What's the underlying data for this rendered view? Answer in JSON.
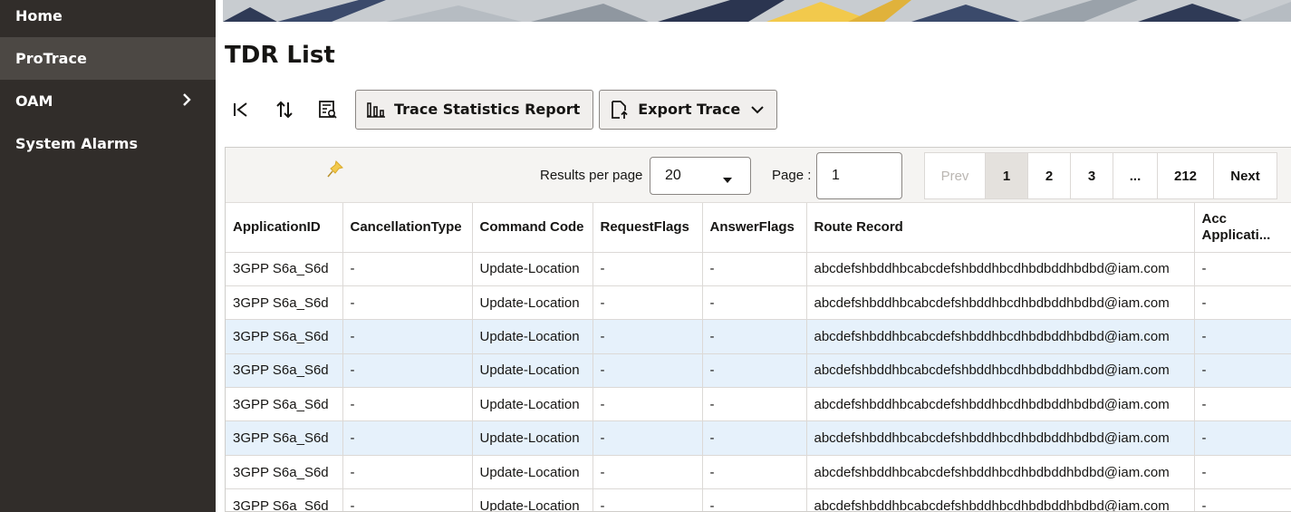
{
  "sidebar": {
    "items": [
      {
        "label": "Home"
      },
      {
        "label": "ProTrace"
      },
      {
        "label": "OAM"
      },
      {
        "label": "System Alarms"
      }
    ]
  },
  "page": {
    "title": "TDR List"
  },
  "toolbar": {
    "first_icon": "first-page-icon",
    "sort_icon": "sort-icon",
    "view_icon": "view-details-icon",
    "trace_stats_label": "Trace Statistics Report",
    "export_label": "Export Trace"
  },
  "pager": {
    "results_label": "Results per page",
    "results_value": "20",
    "page_label": "Page :",
    "page_value": "1",
    "buttons": [
      "Prev",
      "1",
      "2",
      "3",
      "...",
      "212",
      "Next"
    ]
  },
  "table": {
    "headers": [
      "ApplicationID",
      "CancellationType",
      "Command Code",
      "RequestFlags",
      "AnswerFlags",
      "Route Record",
      "Acc Applicati..."
    ],
    "rows": [
      {
        "cells": [
          "3GPP S6a_S6d",
          "-",
          "Update-Location",
          "-",
          "-",
          "abcdefshbddhbcabcdefshbddhbcdhbdbddhbdbd@iam.com",
          "-"
        ],
        "selected": false
      },
      {
        "cells": [
          "3GPP S6a_S6d",
          "-",
          "Update-Location",
          "-",
          "-",
          "abcdefshbddhbcabcdefshbddhbcdhbdbddhbdbd@iam.com",
          "-"
        ],
        "selected": false
      },
      {
        "cells": [
          "3GPP S6a_S6d",
          "-",
          "Update-Location",
          "-",
          "-",
          "abcdefshbddhbcabcdefshbddhbcdhbdbddhbdbd@iam.com",
          "-"
        ],
        "selected": true
      },
      {
        "cells": [
          "3GPP S6a_S6d",
          "-",
          "Update-Location",
          "-",
          "-",
          "abcdefshbddhbcabcdefshbddhbcdhbdbddhbdbd@iam.com",
          "-"
        ],
        "selected": true
      },
      {
        "cells": [
          "3GPP S6a_S6d",
          "-",
          "Update-Location",
          "-",
          "-",
          "abcdefshbddhbcabcdefshbddhbcdhbdbddhbdbd@iam.com",
          "-"
        ],
        "selected": false
      },
      {
        "cells": [
          "3GPP S6a_S6d",
          "-",
          "Update-Location",
          "-",
          "-",
          "abcdefshbddhbcabcdefshbddhbcdhbdbddhbdbd@iam.com",
          "-"
        ],
        "selected": true
      },
      {
        "cells": [
          "3GPP S6a_S6d",
          "-",
          "Update-Location",
          "-",
          "-",
          "abcdefshbddhbcabcdefshbddhbcdhbdbddhbdbd@iam.com",
          "-"
        ],
        "selected": false
      },
      {
        "cells": [
          "3GPP S6a_S6d",
          "-",
          "Update-Location",
          "-",
          "-",
          "abcdefshbddhbcabcdefshbddhbcdhbdbddhbdbd@iam.com",
          "-"
        ],
        "selected": false
      }
    ]
  },
  "colors": {
    "sidebar_bg": "#312d2a",
    "sidebar_active": "#4c4844",
    "selected_row": "#e6f1fb",
    "pin_color": "#f2c94c"
  }
}
